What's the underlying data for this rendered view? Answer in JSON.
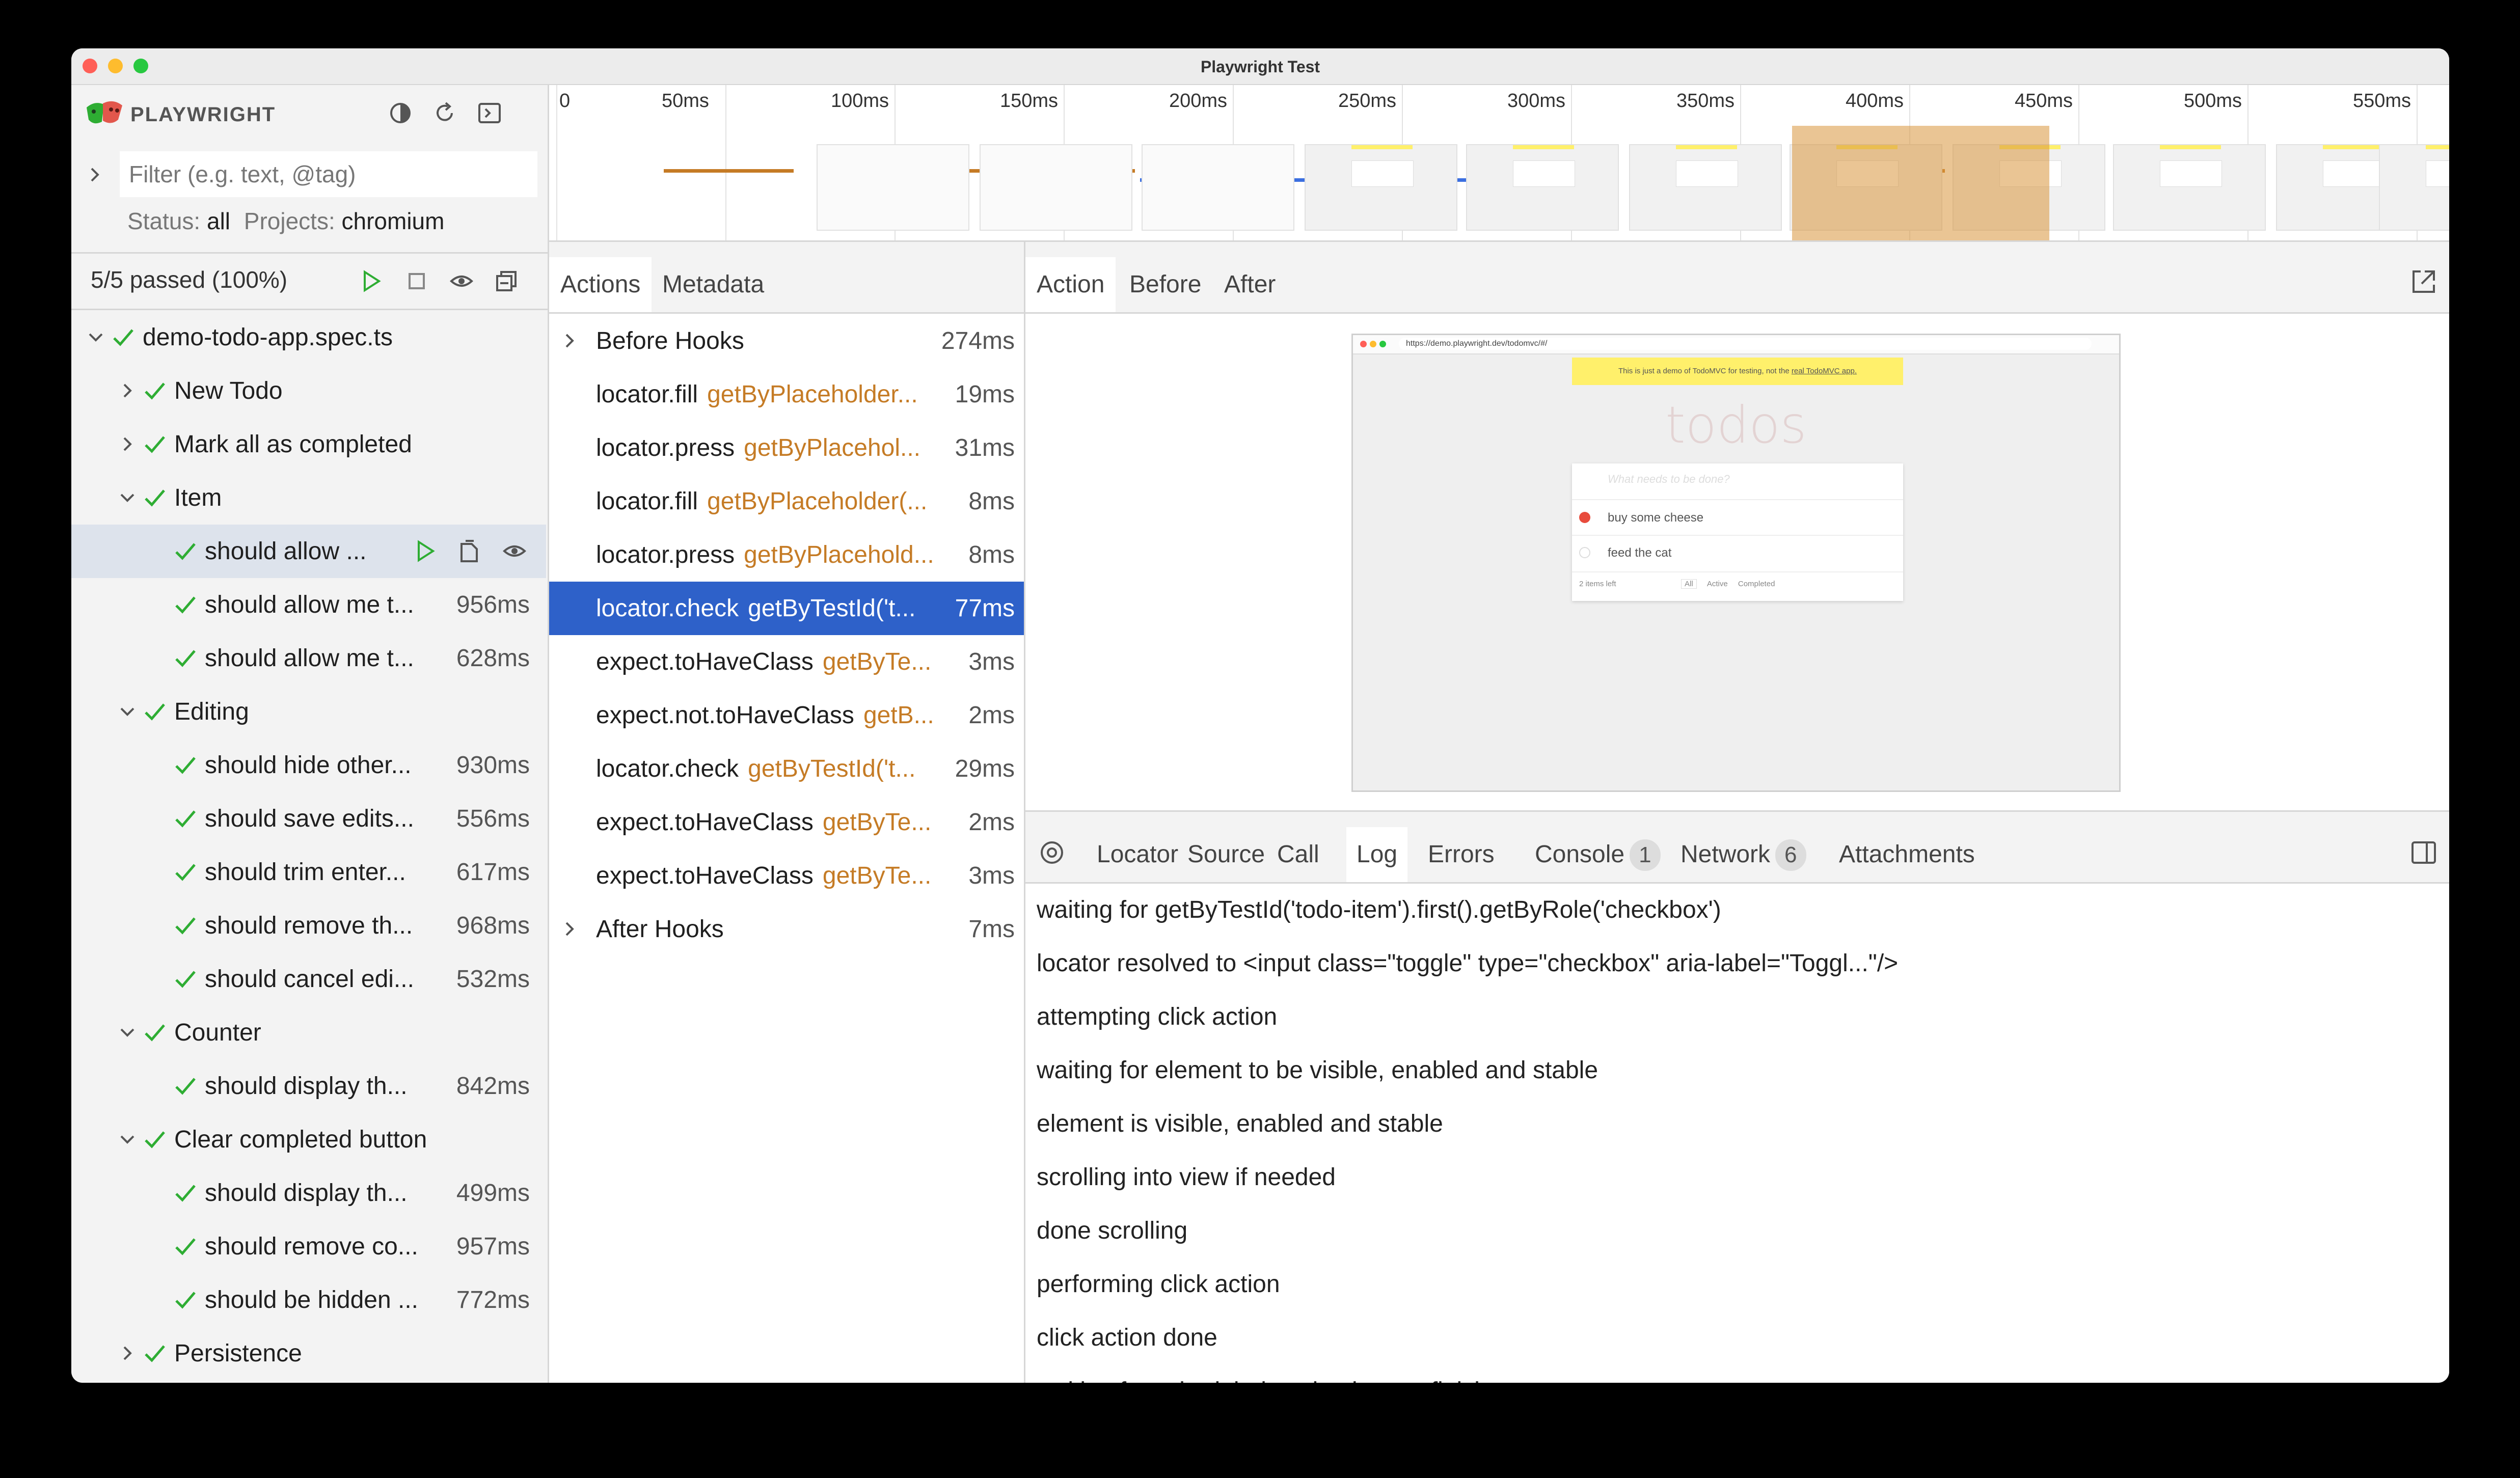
{
  "window": {
    "title": "Playwright Test"
  },
  "sidebar": {
    "brand": "PLAYWRIGHT",
    "filter_placeholder": "Filter (e.g. text, @tag)",
    "status_label": "Status:",
    "status_value": "all",
    "projects_label": "Projects:",
    "projects_value": "chromium",
    "stats": "5/5 passed (100%)",
    "tree": [
      {
        "label": "demo-todo-app.spec.ts",
        "duration": "",
        "level": 0,
        "chevron": "down"
      },
      {
        "label": "New Todo",
        "duration": "",
        "level": 1,
        "chevron": "right"
      },
      {
        "label": "Mark all as completed",
        "duration": "",
        "level": 1,
        "chevron": "right"
      },
      {
        "label": "Item",
        "duration": "",
        "level": 1,
        "chevron": "down"
      },
      {
        "label": "should allow ...",
        "duration": "",
        "level": 2,
        "chevron": "",
        "selected": true
      },
      {
        "label": "should allow me t...",
        "duration": "956ms",
        "level": 2,
        "chevron": ""
      },
      {
        "label": "should allow me t...",
        "duration": "628ms",
        "level": 2,
        "chevron": ""
      },
      {
        "label": "Editing",
        "duration": "",
        "level": 1,
        "chevron": "down"
      },
      {
        "label": "should hide other...",
        "duration": "930ms",
        "level": 2,
        "chevron": ""
      },
      {
        "label": "should save edits...",
        "duration": "556ms",
        "level": 2,
        "chevron": ""
      },
      {
        "label": "should trim enter...",
        "duration": "617ms",
        "level": 2,
        "chevron": ""
      },
      {
        "label": "should remove th...",
        "duration": "968ms",
        "level": 2,
        "chevron": ""
      },
      {
        "label": "should cancel edi...",
        "duration": "532ms",
        "level": 2,
        "chevron": ""
      },
      {
        "label": "Counter",
        "duration": "",
        "level": 1,
        "chevron": "down"
      },
      {
        "label": "should display th...",
        "duration": "842ms",
        "level": 2,
        "chevron": ""
      },
      {
        "label": "Clear completed button",
        "duration": "",
        "level": 1,
        "chevron": "down"
      },
      {
        "label": "should display th...",
        "duration": "499ms",
        "level": 2,
        "chevron": ""
      },
      {
        "label": "should remove co...",
        "duration": "957ms",
        "level": 2,
        "chevron": ""
      },
      {
        "label": "should be hidden ...",
        "duration": "772ms",
        "level": 2,
        "chevron": ""
      },
      {
        "label": "Persistence",
        "duration": "",
        "level": 1,
        "chevron": "right"
      }
    ]
  },
  "timeline": {
    "ticks": [
      "0",
      "50ms",
      "100ms",
      "150ms",
      "200ms",
      "250ms",
      "300ms",
      "350ms",
      "400ms",
      "450ms",
      "500ms",
      "550ms"
    ]
  },
  "actions_panel": {
    "tabs": [
      "Actions",
      "Metadata"
    ],
    "items": [
      {
        "name": "Before Hooks",
        "locator": "",
        "duration": "274ms",
        "chevron": true
      },
      {
        "name": "locator.fill",
        "locator": "getByPlaceholder...",
        "duration": "19ms"
      },
      {
        "name": "locator.press",
        "locator": "getByPlacehol...",
        "duration": "31ms"
      },
      {
        "name": "locator.fill",
        "locator": "getByPlaceholder(...",
        "duration": "8ms"
      },
      {
        "name": "locator.press",
        "locator": "getByPlacehold...",
        "duration": "8ms"
      },
      {
        "name": "locator.check",
        "locator": "getByTestId('t...",
        "duration": "77ms",
        "selected": true
      },
      {
        "name": "expect.toHaveClass",
        "locator": "getByTe...",
        "duration": "3ms"
      },
      {
        "name": "expect.not.toHaveClass",
        "locator": "getB...",
        "duration": "2ms"
      },
      {
        "name": "locator.check",
        "locator": "getByTestId('t...",
        "duration": "29ms"
      },
      {
        "name": "expect.toHaveClass",
        "locator": "getByTe...",
        "duration": "2ms"
      },
      {
        "name": "expect.toHaveClass",
        "locator": "getByTe...",
        "duration": "3ms"
      },
      {
        "name": "After Hooks",
        "locator": "",
        "duration": "7ms",
        "chevron": true
      }
    ]
  },
  "preview": {
    "tabs": [
      "Action",
      "Before",
      "After"
    ],
    "snapshot": {
      "url": "https://demo.playwright.dev/todomvc/#/",
      "banner_text": "This is just a demo of TodoMVC for testing, not the",
      "banner_link": "real TodoMVC app.",
      "heading": "todos",
      "input_placeholder": "What needs to be done?",
      "todos": [
        "buy some cheese",
        "feed the cat"
      ],
      "footer_count": "2 items left",
      "filters": [
        "All",
        "Active",
        "Completed"
      ]
    }
  },
  "details": {
    "tabs": [
      {
        "label": "Locator",
        "badge": ""
      },
      {
        "label": "Source",
        "badge": ""
      },
      {
        "label": "Call",
        "badge": ""
      },
      {
        "label": "Log",
        "badge": ""
      },
      {
        "label": "Errors",
        "badge": ""
      },
      {
        "label": "Console",
        "badge": "1"
      },
      {
        "label": "Network",
        "badge": "6"
      },
      {
        "label": "Attachments",
        "badge": ""
      }
    ],
    "log": [
      "waiting for getByTestId('todo-item').first().getByRole('checkbox')",
      "locator resolved to <input class=\"toggle\" type=\"checkbox\" aria-label=\"Toggl...\"/>",
      "attempting click action",
      "waiting for element to be visible, enabled and stable",
      "element is visible, enabled and stable",
      "scrolling into view if needed",
      "done scrolling",
      "performing click action",
      "click action done",
      "waiting for scheduled navigations to finish"
    ]
  }
}
